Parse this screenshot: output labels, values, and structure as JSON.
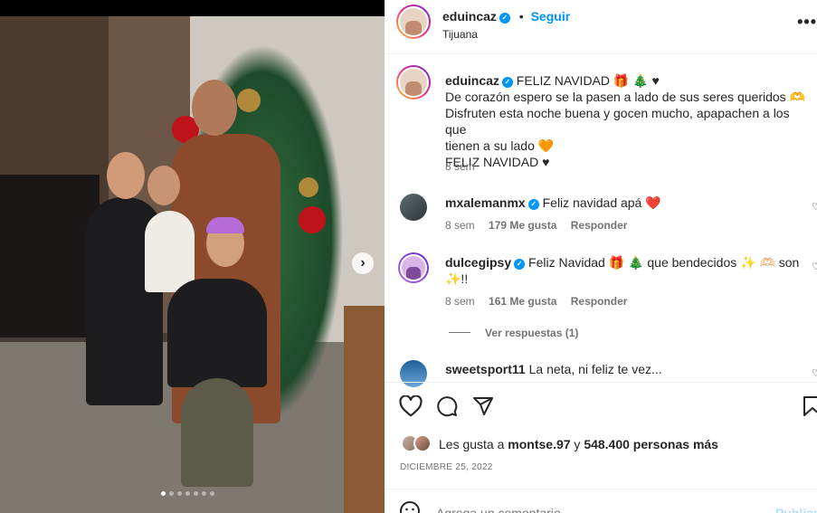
{
  "post": {
    "author": "eduincaz",
    "location": "Tijuana",
    "follow_label": "Seguir",
    "caption_lines": [
      "FELIZ NAVIDAD 🎁 🎄 ♥",
      "De corazón espero se la pasen a lado de sus seres queridos 🫶",
      "Disfruten esta noche buena y gocen mucho, apapachen a los que",
      "tienen a su lado 🧡",
      "FELIZ NAVIDAD ♥"
    ],
    "caption_time": "8 sem",
    "likes_prefix": "Les gusta a",
    "likes_user": "montse.97",
    "likes_mid": "y",
    "likes_count": "548.400 personas más",
    "date": "DICIEMBRE 25, 2022",
    "comment_placeholder": "Agrega un comentario...",
    "publish_label": "Publicar",
    "carousel_total": 7,
    "carousel_active": 1
  },
  "comments": [
    {
      "user": "mxalemanmx",
      "text": "Feliz navidad apá ❤️",
      "time": "8 sem",
      "likes": "179 Me gusta",
      "reply": "Responder",
      "verified": true
    },
    {
      "user": "dulcegipsy",
      "text": "Feliz Navidad 🎁 🎄 que bendecidos ✨ 🫶🏻 son",
      "text2": "✨!!",
      "time": "8 sem",
      "likes": "161 Me gusta",
      "reply": "Responder",
      "verified": true
    },
    {
      "user": "sweetsport11",
      "text": "La neta, ni feliz te vez...",
      "verified": false
    }
  ],
  "view_replies": "Ver respuestas (1)",
  "colors": {
    "accent": "#0095f6",
    "text": "#262626",
    "muted": "#737373"
  }
}
